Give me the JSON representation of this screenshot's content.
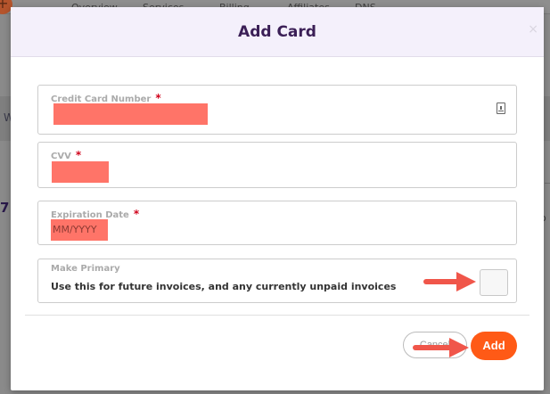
{
  "background": {
    "nav_items": [
      "Overview",
      "Services",
      "Billing",
      "Affiliates",
      "DNS"
    ],
    "left_text_1": "W",
    "left_text_2": "7",
    "right_text": "o"
  },
  "modal": {
    "title": "Add Card",
    "close_label": "×",
    "fields": {
      "card_number": {
        "label": "Credit Card Number",
        "required_mark": "*"
      },
      "cvv": {
        "label": "CVV",
        "required_mark": "*"
      },
      "expiration": {
        "label": "Expiration Date",
        "required_mark": "*",
        "placeholder": "MM/YYYY"
      }
    },
    "make_primary": {
      "label": "Make Primary",
      "description": "Use this for future invoices, and any currently unpaid invoices",
      "checked": false
    },
    "buttons": {
      "cancel_label": "Cancel",
      "add_label": "Add"
    }
  },
  "colors": {
    "accent": "#ff5a16",
    "title": "#3b1f56",
    "header_bg": "#f4f0fb",
    "redaction": "#ff7468",
    "arrow": "#f0564a"
  },
  "icons": {
    "card_field_icon": "contact-card-icon"
  }
}
